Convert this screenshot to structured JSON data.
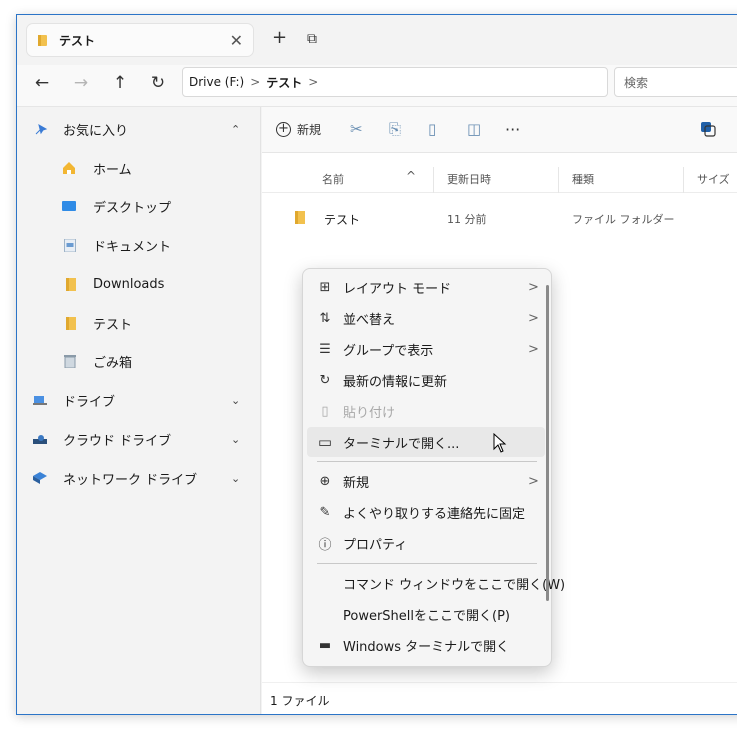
{
  "tab": {
    "label": "テスト",
    "close": "✕"
  },
  "toolbar": {
    "new_tab": "+",
    "duplicate": "⧉"
  },
  "address": {
    "back": "←",
    "forward": "→",
    "up": "↑",
    "refresh": "↻",
    "segments": [
      "Drive (F:)",
      "テスト"
    ],
    "separator": ">",
    "search_placeholder": "検索"
  },
  "sidebar": {
    "items": [
      {
        "label": "お気に入り",
        "icon": "pin-icon",
        "chevron": "⌃"
      },
      {
        "label": "ホーム",
        "icon": "home-icon"
      },
      {
        "label": "デスクトップ",
        "icon": "desktop-icon"
      },
      {
        "label": "ドキュメント",
        "icon": "document-icon"
      },
      {
        "label": "Downloads",
        "icon": "folder-icon"
      },
      {
        "label": "テスト",
        "icon": "folder-icon"
      },
      {
        "label": "ごみ箱",
        "icon": "recycle-bin-icon"
      },
      {
        "label": "ドライブ",
        "icon": "drive-icon",
        "chevron": "⌄"
      },
      {
        "label": "クラウド ドライブ",
        "icon": "cloud-drive-icon",
        "chevron": "⌄"
      },
      {
        "label": "ネットワーク ドライブ",
        "icon": "network-drive-icon",
        "chevron": "⌄"
      }
    ]
  },
  "command_bar": {
    "new_label": "新規",
    "more": "···"
  },
  "columns": {
    "name": "名前",
    "sort": "^",
    "modified": "更新日時",
    "type": "種類",
    "size": "サイズ"
  },
  "files": [
    {
      "name": "テスト",
      "modified": "11 分前",
      "type": "ファイル フォルダー"
    }
  ],
  "status": {
    "count": "1 ファイル"
  },
  "context_menu": {
    "items": [
      {
        "label": "レイアウト モード",
        "icon": "⊞",
        "arrow": ">"
      },
      {
        "label": "並べ替え",
        "icon": "⇅",
        "arrow": ">"
      },
      {
        "label": "グループで表示",
        "icon": "☰",
        "arrow": ">"
      },
      {
        "label": "最新の情報に更新",
        "icon": "↻"
      },
      {
        "label": "貼り付け",
        "icon": "▯"
      },
      {
        "label": "ターミナルで開く...",
        "icon": "▭"
      },
      {
        "label": "新規",
        "icon": "⊕",
        "arrow": ">"
      },
      {
        "label": "よくやり取りする連絡先に固定",
        "icon": "✎"
      },
      {
        "label": "プロパティ",
        "icon": "ⓘ"
      },
      {
        "label": "コマンド ウィンドウをここで開く(W)"
      },
      {
        "label": "PowerShellをここで開く(P)"
      },
      {
        "label": "Windows ターミナルで開く",
        "icon": "▬"
      }
    ]
  },
  "colors": {
    "accent": "#2b74c7",
    "folder": "#f2c14e"
  }
}
